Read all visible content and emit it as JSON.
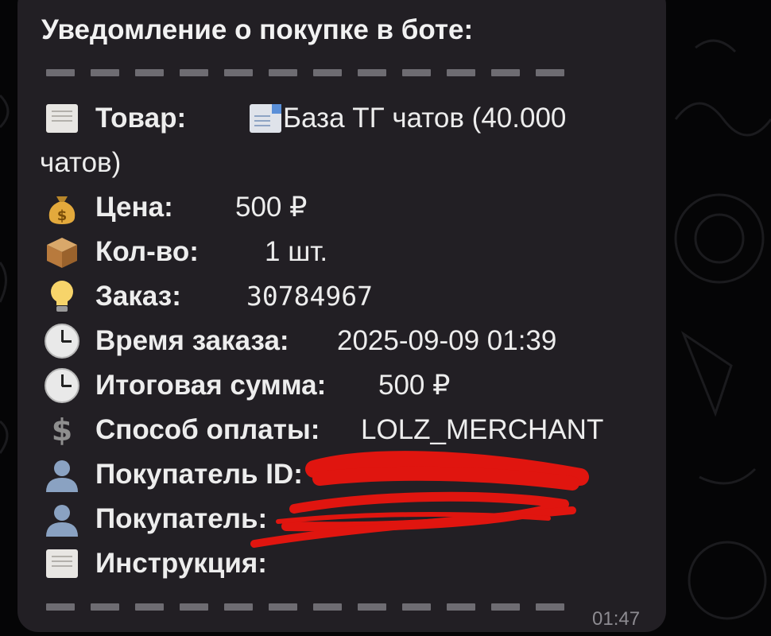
{
  "message": {
    "title": "Уведомление о покупке в боте:",
    "product": {
      "label": "Товар:",
      "value_line1": "База ТГ чатов (40.000",
      "value_line2": "чатов)"
    },
    "price": {
      "label": "Цена:",
      "value": "500 ₽"
    },
    "quantity": {
      "label": "Кол-во:",
      "value": "1 шт."
    },
    "order": {
      "label": "Заказ:",
      "value": "30784967"
    },
    "order_time": {
      "label": "Время заказа:",
      "value": "2025-09-09 01:39"
    },
    "total": {
      "label": "Итоговая сумма:",
      "value": "500 ₽"
    },
    "payment": {
      "label": "Способ оплаты:",
      "value": "LOLZ_MERCHANT"
    },
    "buyer_id": {
      "label": "Покупатель ID:"
    },
    "buyer": {
      "label": "Покупатель:"
    },
    "instruction": {
      "label": "Инструкция:"
    },
    "time": "01:47"
  },
  "icons": {
    "product": "page-icon",
    "product_value": "document-icon",
    "price": "money-bag-icon",
    "quantity": "package-icon",
    "order": "lightbulb-icon",
    "order_time": "clock-icon",
    "total": "clock-icon",
    "payment": "dollar-icon",
    "buyer_id": "user-icon",
    "buyer": "user-icon",
    "instruction": "page-icon"
  },
  "colors": {
    "background": "#050506",
    "bubble": "#221f24",
    "text": "#ededed",
    "separator": "#6e6c72",
    "timestamp": "#8d8b91",
    "redaction": "#e0150f"
  }
}
